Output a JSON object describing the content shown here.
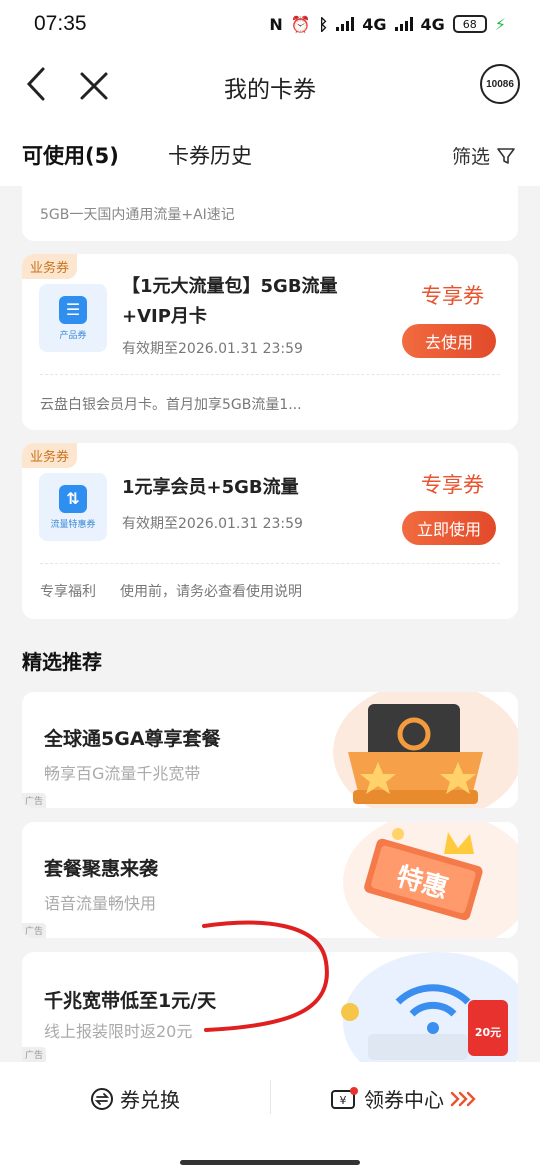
{
  "status": {
    "time": "07:35",
    "net1": "4G",
    "net2": "4G",
    "battery": "68"
  },
  "nav": {
    "title": "我的卡券",
    "service_label": "10086"
  },
  "tabs": {
    "active": "可使用(5)",
    "history": "卡券历史",
    "filter": "筛选"
  },
  "top_card": {
    "desc": "5GB一天国内通用流量+AI速记"
  },
  "coupons": [
    {
      "tag": "业务券",
      "icon_caption": "产品券",
      "title": "【1元大流量包】5GB流量+VIP月卡",
      "validity": "有效期至2026.01.31 23:59",
      "badge": "专享券",
      "button": "去使用",
      "note_label": "",
      "note": "云盘白银会员月卡。首月加享5GB流量1..."
    },
    {
      "tag": "业务券",
      "icon_caption": "流量特惠券",
      "title": "1元享会员+5GB流量",
      "validity": "有效期至2026.01.31 23:59",
      "badge": "专享券",
      "button": "立即使用",
      "note_label": "专享福利",
      "note": "使用前，请务必查看使用说明"
    }
  ],
  "section": {
    "title": "精选推荐"
  },
  "promos": [
    {
      "title": "全球通5GA尊享套餐",
      "subtitle": "畅享百G流量千兆宽带",
      "ad": "广告"
    },
    {
      "title": "套餐聚惠来袭",
      "subtitle": "语音流量畅快用",
      "ad": "广告",
      "art_text": "特惠"
    },
    {
      "title": "千兆宽带低至1元/天",
      "subtitle": "线上报装限时返20元",
      "ad": "广告",
      "art_text": "20元"
    }
  ],
  "bottom": {
    "exchange": "券兑换",
    "center": "领券中心"
  },
  "colors": {
    "accent": "#e8542e",
    "tag_bg": "#fde6cf",
    "blue": "#2f8ff0",
    "annotation": "#e02020"
  }
}
